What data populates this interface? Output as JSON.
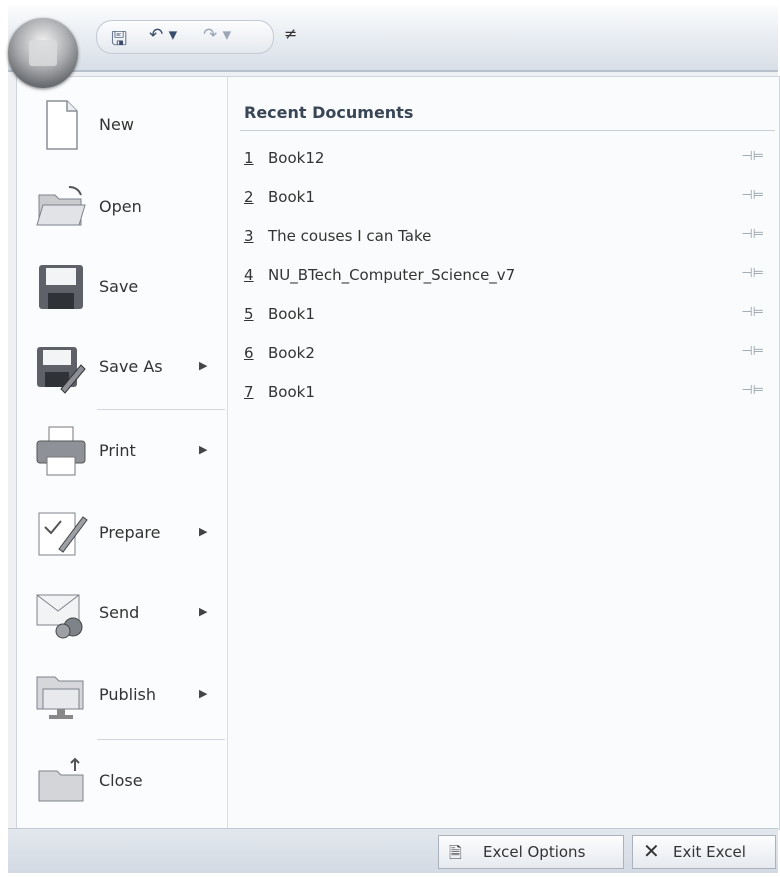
{
  "quick_access": {
    "save_icon": "save-icon",
    "undo_icon": "undo-icon",
    "redo_icon": "redo-icon",
    "customize_glyph": "≠"
  },
  "menu": {
    "items": [
      {
        "label": "New",
        "icon": "new-document-icon"
      },
      {
        "label": "Open",
        "icon": "open-folder-icon"
      },
      {
        "label": "Save",
        "icon": "save-disk-icon"
      },
      {
        "label": "Save As",
        "icon": "save-as-icon",
        "submenu": true
      },
      {
        "label": "Print",
        "icon": "printer-icon",
        "submenu": true
      },
      {
        "label": "Prepare",
        "icon": "prepare-icon",
        "submenu": true
      },
      {
        "label": "Send",
        "icon": "send-icon",
        "submenu": true
      },
      {
        "label": "Publish",
        "icon": "publish-icon",
        "submenu": true
      },
      {
        "label": "Close",
        "icon": "close-folder-icon"
      }
    ]
  },
  "recent": {
    "title": "Recent Documents",
    "documents": [
      {
        "num": "1",
        "name": "Book12"
      },
      {
        "num": "2",
        "name": "Book1"
      },
      {
        "num": "3",
        "name": "The couses I can Take"
      },
      {
        "num": "4",
        "name": "NU_BTech_Computer_Science_v7"
      },
      {
        "num": "5",
        "name": "Book1"
      },
      {
        "num": "6",
        "name": "Book2"
      },
      {
        "num": "7",
        "name": "Book1"
      }
    ]
  },
  "footer": {
    "options_label": "Excel Options",
    "exit_label": "Exit Excel"
  },
  "colors": {
    "menu_bg": "#ffffff",
    "chrome": "#e3e8ee",
    "text": "#333333"
  }
}
